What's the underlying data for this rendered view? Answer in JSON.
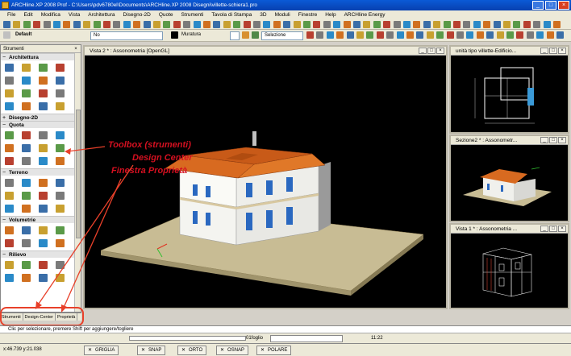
{
  "window": {
    "title": "ARCHline.XP 2008 Prof - C:\\Users\\pdv6780el\\Documents\\ARCHline.XP 2008 Disegni\\villette-schiera1.pro"
  },
  "menu": [
    "File",
    "Edit",
    "Modifica",
    "Vista",
    "Architettura",
    "Disegno-2D",
    "Quote",
    "Strumenti",
    "Tavola di Stampa",
    "3D",
    "Moduli",
    "Finestre",
    "Help",
    "ARCHline Energy"
  ],
  "toolbar2": {
    "style": "Default",
    "layer": "No",
    "material": "Muratura",
    "selection": "Selezione"
  },
  "panel": {
    "title": "Strumenti",
    "sections": [
      {
        "label": "Architettura",
        "collapsed": false
      },
      {
        "label": "Disegno-2D",
        "collapsed": true
      },
      {
        "label": "Quota",
        "collapsed": false
      },
      {
        "label": "Terreno",
        "collapsed": false
      },
      {
        "label": "Volumetrie",
        "collapsed": false
      },
      {
        "label": "Rilievo",
        "collapsed": false
      }
    ],
    "tabs": [
      "Strumenti",
      "Design-Center",
      "Proprietà"
    ]
  },
  "viewports": {
    "main": "Vista 2 * : Assonometria [OpenGL]",
    "plan": "unità tipo villette-Edificio...",
    "section": "Sezione2 * : Assonometr...",
    "view1": "Vista 1 * : Assonometria ..."
  },
  "annotation": {
    "line1": "Toolbox (strumenti)",
    "line2": "Design Center",
    "line3": "Finestra Proprietà"
  },
  "cmdline": {
    "prompt": "Clic per selezionare, premere Shift per aggiungere/togliere",
    "zoom": "01foglio",
    "time": "11:22"
  },
  "status": {
    "coords": "x:46.739  y:21.038",
    "toggles": [
      "GRIGLIA",
      "SNAP",
      "ORTO",
      "OSNAP",
      "POLARE"
    ]
  }
}
